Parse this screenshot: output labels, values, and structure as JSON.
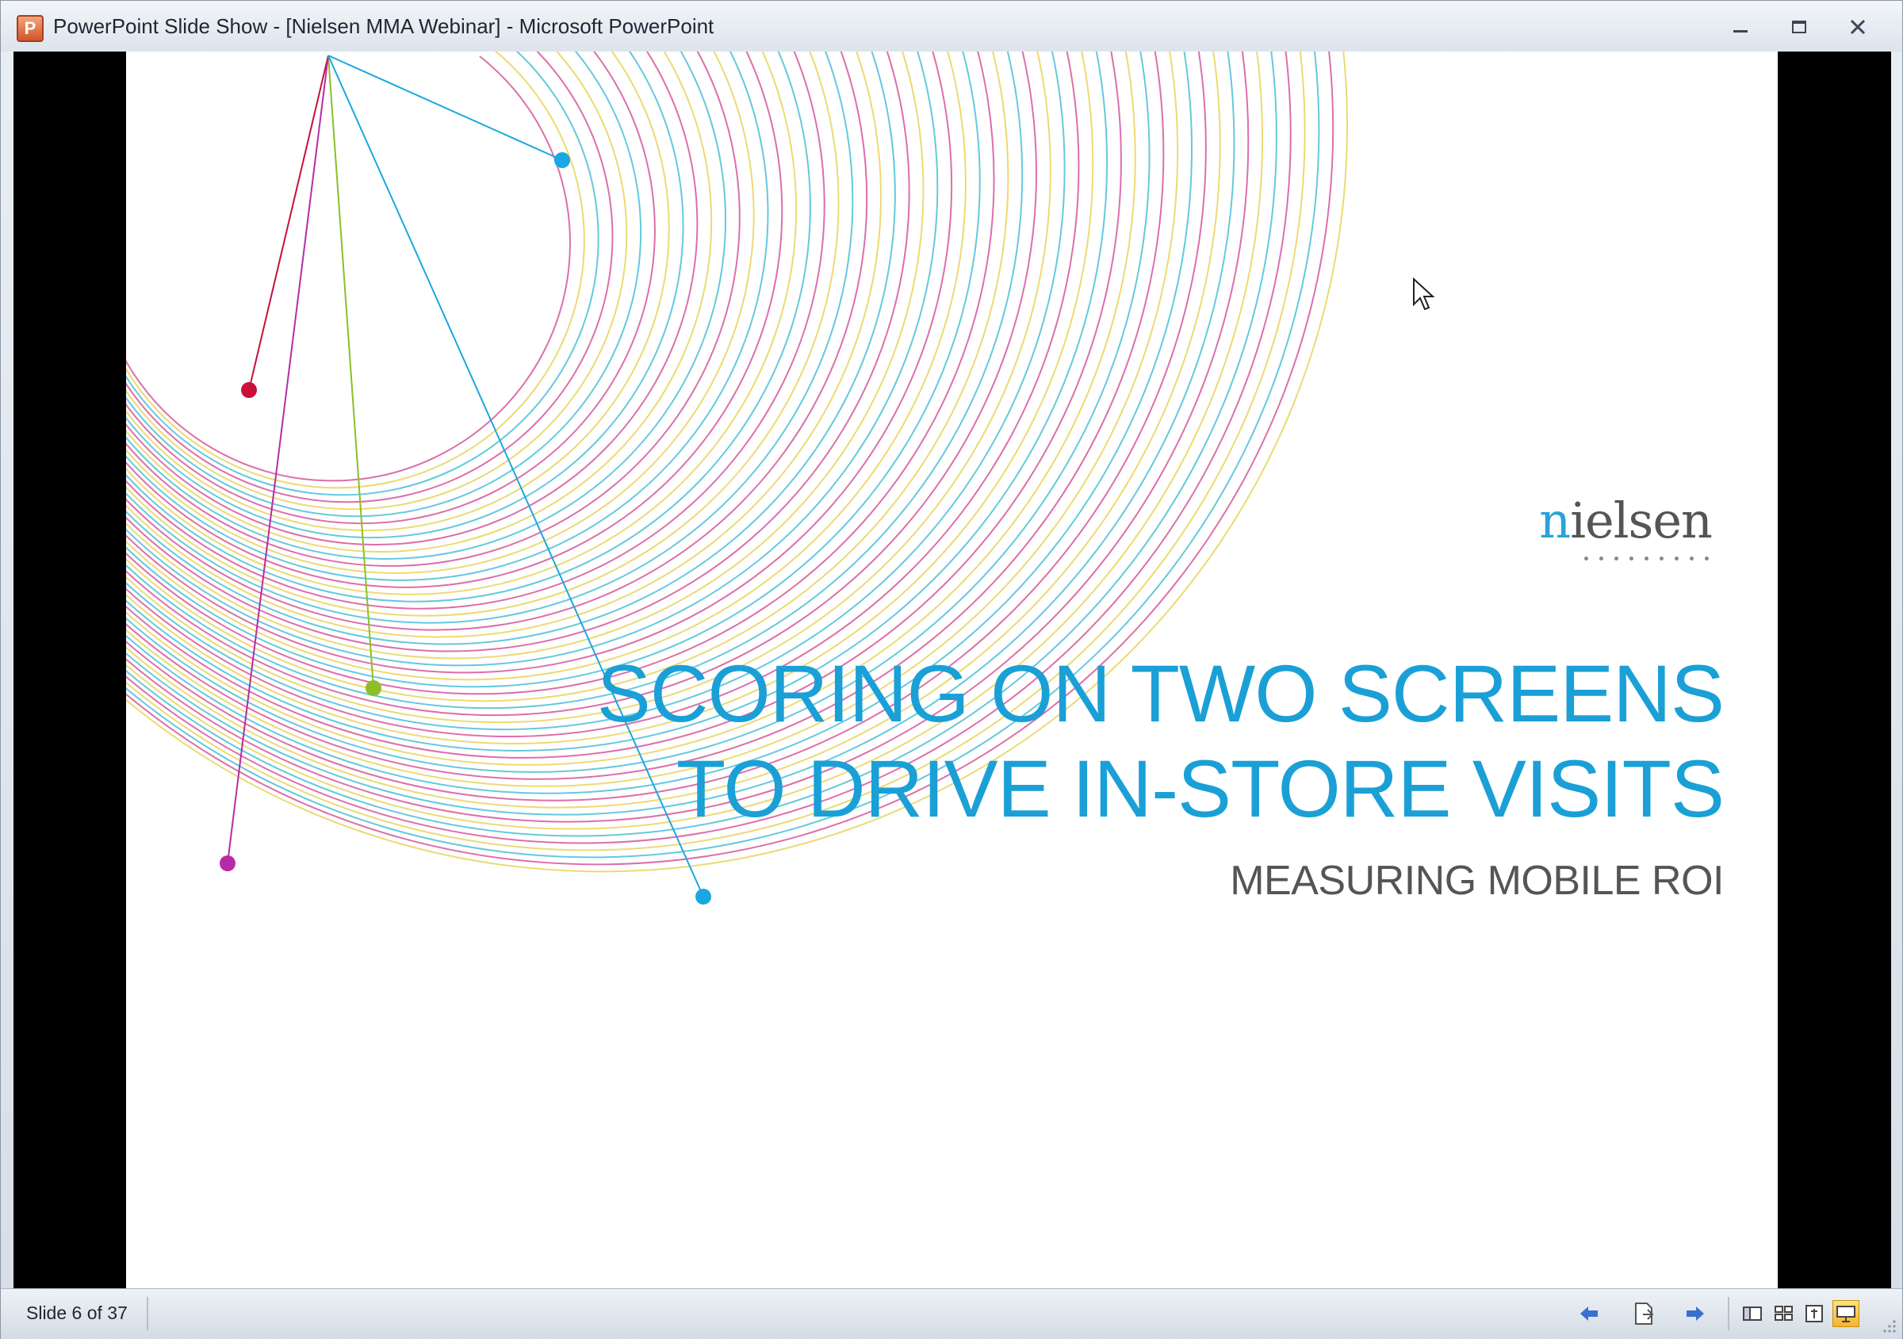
{
  "window": {
    "title": "PowerPoint Slide Show - [Nielsen MMA Webinar] - Microsoft PowerPoint",
    "app_icon_letter": "P",
    "icon": "powerpoint-icon"
  },
  "slide": {
    "logo": "nielsen",
    "title_line_1": "SCORING ON TWO SCREENS",
    "title_line_2": "TO DRIVE IN-STORE VISITS",
    "subtitle": "MEASURING MOBILE ROI",
    "colors": {
      "title": "#1aa0d6",
      "subtitle": "#555555",
      "arc_magenta": "#d6569a",
      "arc_yellow": "#e8d35a",
      "arc_cyan": "#49bfd6",
      "dot_red": "#c8103a",
      "dot_green": "#8cbf26",
      "dot_purple": "#b62ca6",
      "dot_blue": "#1ba7e0"
    }
  },
  "statusbar": {
    "slide_counter": "Slide 6 of 37",
    "icons": [
      "previous-slide-icon",
      "notes-icon",
      "next-slide-icon",
      "normal-view-icon",
      "slide-sorter-icon",
      "reading-view-icon",
      "slide-show-icon"
    ]
  }
}
